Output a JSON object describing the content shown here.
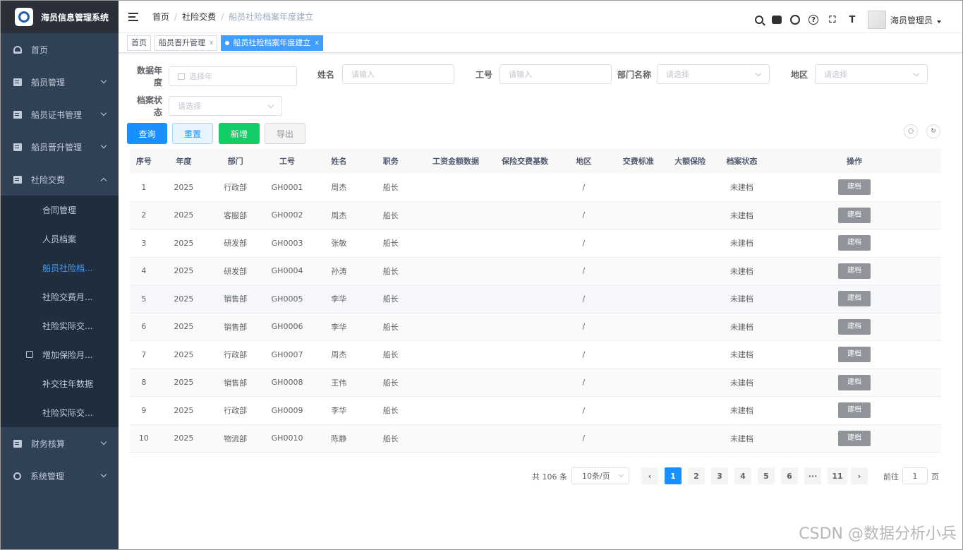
{
  "app": {
    "title": "海员信息管理系统"
  },
  "sidebar": {
    "items": [
      {
        "label": "首页",
        "icon": "dashboard-icon"
      },
      {
        "label": "船员管理",
        "icon": "document-icon"
      },
      {
        "label": "船员证书管理",
        "icon": "document-icon"
      },
      {
        "label": "船员晋升管理",
        "icon": "document-icon"
      },
      {
        "label": "社险交费",
        "icon": "document-icon"
      },
      {
        "label": "财务核算",
        "icon": "document-icon"
      },
      {
        "label": "系统管理",
        "icon": "gear-icon"
      }
    ],
    "sub": [
      "合同管理",
      "人员档案",
      "船员社险档...",
      "社险交费月...",
      "社险实际交...",
      "增加保险月...",
      "补交往年数据",
      "社险实际交..."
    ]
  },
  "navbar": {
    "breadcrumb": [
      "首页",
      "社险交费",
      "船员社险档案年度建立"
    ],
    "user": "海员管理员"
  },
  "tags": [
    "首页",
    "船员晋升管理",
    "船员社险档案年度建立"
  ],
  "filters": {
    "year_label": "数据年度",
    "year_ph": "选择年",
    "name_label": "姓名",
    "name_ph": "请输入",
    "empno_label": "工号",
    "empno_ph": "请输入",
    "dept_label": "部门名称",
    "dept_ph": "请选择",
    "region_label": "地区",
    "region_ph": "请选择",
    "status_label": "档案状态",
    "status_ph": "请选择"
  },
  "buttons": {
    "query": "查询",
    "reset": "重置",
    "add": "新增",
    "export": "导出"
  },
  "table": {
    "headers": [
      "序号",
      "年度",
      "部门",
      "工号",
      "姓名",
      "职务",
      "工资金额数据",
      "保险交费基数",
      "地区",
      "交费标准",
      "大额保险",
      "档案状态",
      "操作"
    ],
    "rows": [
      [
        "1",
        "2025",
        "行政部",
        "GH0001",
        "周杰",
        "船长",
        "",
        "",
        "/",
        "",
        "",
        "未建档",
        "建档"
      ],
      [
        "2",
        "2025",
        "客服部",
        "GH0002",
        "周杰",
        "船长",
        "",
        "",
        "/",
        "",
        "",
        "未建档",
        "建档"
      ],
      [
        "3",
        "2025",
        "研发部",
        "GH0003",
        "张敏",
        "船长",
        "",
        "",
        "/",
        "",
        "",
        "未建档",
        "建档"
      ],
      [
        "4",
        "2025",
        "研发部",
        "GH0004",
        "孙涛",
        "船长",
        "",
        "",
        "/",
        "",
        "",
        "未建档",
        "建档"
      ],
      [
        "5",
        "2025",
        "销售部",
        "GH0005",
        "李华",
        "船长",
        "",
        "",
        "/",
        "",
        "",
        "未建档",
        "建档"
      ],
      [
        "6",
        "2025",
        "销售部",
        "GH0006",
        "李华",
        "船长",
        "",
        "",
        "/",
        "",
        "",
        "未建档",
        "建档"
      ],
      [
        "7",
        "2025",
        "行政部",
        "GH0007",
        "周杰",
        "船长",
        "",
        "",
        "/",
        "",
        "",
        "未建档",
        "建档"
      ],
      [
        "8",
        "2025",
        "销售部",
        "GH0008",
        "王伟",
        "船长",
        "",
        "",
        "/",
        "",
        "",
        "未建档",
        "建档"
      ],
      [
        "9",
        "2025",
        "行政部",
        "GH0009",
        "李华",
        "船长",
        "",
        "",
        "/",
        "",
        "",
        "未建档",
        "建档"
      ],
      [
        "10",
        "2025",
        "物流部",
        "GH0010",
        "陈静",
        "船长",
        "",
        "",
        "/",
        "",
        "",
        "未建档",
        "建档"
      ]
    ]
  },
  "pagination": {
    "total": "共 106 条",
    "size": "10条/页",
    "pages": [
      "1",
      "2",
      "3",
      "4",
      "5",
      "6",
      "···",
      "11"
    ],
    "current": "1",
    "goto": "前往",
    "goto_val": "1",
    "page_unit": "页"
  },
  "watermark": "CSDN @数据分析小兵"
}
